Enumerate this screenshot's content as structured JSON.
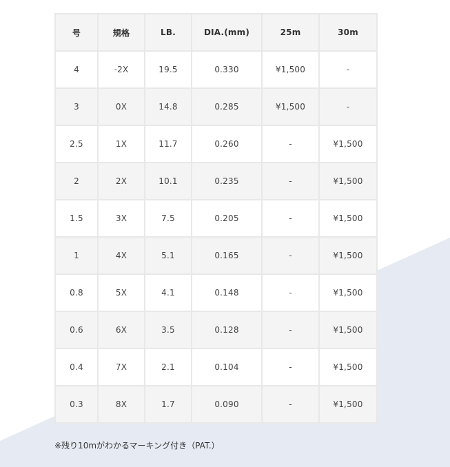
{
  "colors": {
    "header_bg": "#f4f4f4",
    "row_alt_bg": "#f4f4f4",
    "row_bg": "#ffffff",
    "border": "#e8e8e8",
    "text": "#333333",
    "background_shape": "#e6eaf2"
  },
  "table": {
    "headers": [
      "号",
      "規格",
      "LB.",
      "DIA.(mm)",
      "25m",
      "30m"
    ],
    "rows": [
      [
        "4",
        "-2X",
        "19.5",
        "0.330",
        "¥1,500",
        "-"
      ],
      [
        "3",
        "0X",
        "14.8",
        "0.285",
        "¥1,500",
        "-"
      ],
      [
        "2.5",
        "1X",
        "11.7",
        "0.260",
        "-",
        "¥1,500"
      ],
      [
        "2",
        "2X",
        "10.1",
        "0.235",
        "-",
        "¥1,500"
      ],
      [
        "1.5",
        "3X",
        "7.5",
        "0.205",
        "-",
        "¥1,500"
      ],
      [
        "1",
        "4X",
        "5.1",
        "0.165",
        "-",
        "¥1,500"
      ],
      [
        "0.8",
        "5X",
        "4.1",
        "0.148",
        "-",
        "¥1,500"
      ],
      [
        "0.6",
        "6X",
        "3.5",
        "0.128",
        "-",
        "¥1,500"
      ],
      [
        "0.4",
        "7X",
        "2.1",
        "0.104",
        "-",
        "¥1,500"
      ],
      [
        "0.3",
        "8X",
        "1.7",
        "0.090",
        "-",
        "¥1,500"
      ]
    ]
  },
  "footnote": "※残り10mがわかるマーキング付き（PAT.）"
}
